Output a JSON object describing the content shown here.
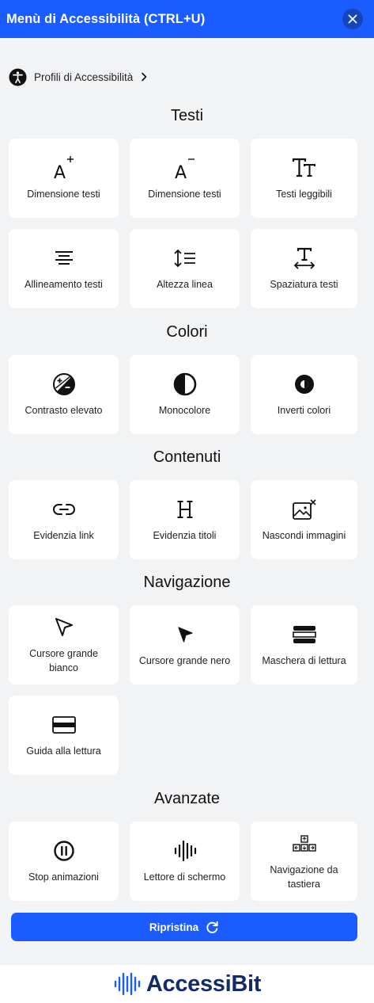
{
  "header": {
    "title": "Menù di Accessibilità (CTRL+U)"
  },
  "profiles": {
    "label": "Profili di Accessibilità"
  },
  "sections": {
    "testi": {
      "title": "Testi",
      "items": [
        "Dimensione testi",
        "Dimensione testi",
        "Testi leggibili",
        "Allineamento testi",
        "Altezza linea",
        "Spaziatura testi"
      ]
    },
    "colori": {
      "title": "Colori",
      "items": [
        "Contrasto elevato",
        "Monocolore",
        "Inverti colori"
      ]
    },
    "contenuti": {
      "title": "Contenuti",
      "items": [
        "Evidenzia link",
        "Evidenzia titoli",
        "Nascondi immagini"
      ]
    },
    "navigazione": {
      "title": "Navigazione",
      "items": [
        "Cursore grande bianco",
        "Cursore grande nero",
        "Maschera di lettura",
        "Guida alla lettura"
      ]
    },
    "avanzate": {
      "title": "Avanzate",
      "items": [
        "Stop animazioni",
        "Lettore di schermo",
        "Navigazione da tastiera"
      ]
    }
  },
  "reset": {
    "label": "Ripristina"
  },
  "footer": {
    "brand_a": "Accessi",
    "brand_b": "Bit"
  },
  "colors": {
    "accent": "#1a5cff",
    "brand_dark": "#152a6b",
    "background": "#f2f3f5"
  }
}
